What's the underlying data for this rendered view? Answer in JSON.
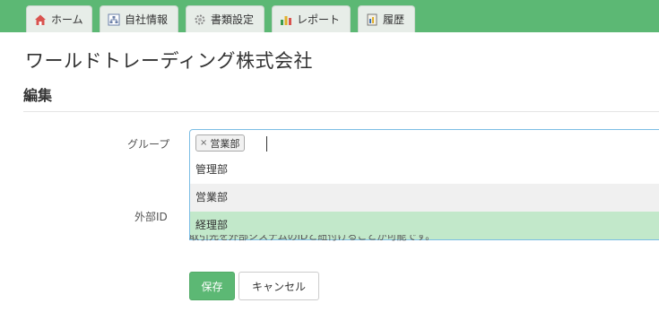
{
  "tabs": [
    {
      "label": "ホーム",
      "icon": "home-icon"
    },
    {
      "label": "自社情報",
      "icon": "org-chart-icon"
    },
    {
      "label": "書類設定",
      "icon": "gear-icon"
    },
    {
      "label": "レポート",
      "icon": "bar-chart-icon"
    },
    {
      "label": "履歴",
      "icon": "history-book-icon"
    }
  ],
  "page": {
    "title": "ワールドトレーディング株式会社",
    "section": "編集"
  },
  "form": {
    "group_label": "グループ",
    "selected_chip": "営業部",
    "chip_remove": "×",
    "options": [
      "管理部",
      "営業部",
      "経理部"
    ],
    "extid_label": "外部ID",
    "help_text": "取引先を外部システムのIDと紐付けることが可能です。",
    "save_label": "保存",
    "cancel_label": "キャンセル"
  },
  "colors": {
    "brand_green": "#5cb874",
    "highlight": "#c2e8ca",
    "focus_border": "#7bbde4"
  }
}
